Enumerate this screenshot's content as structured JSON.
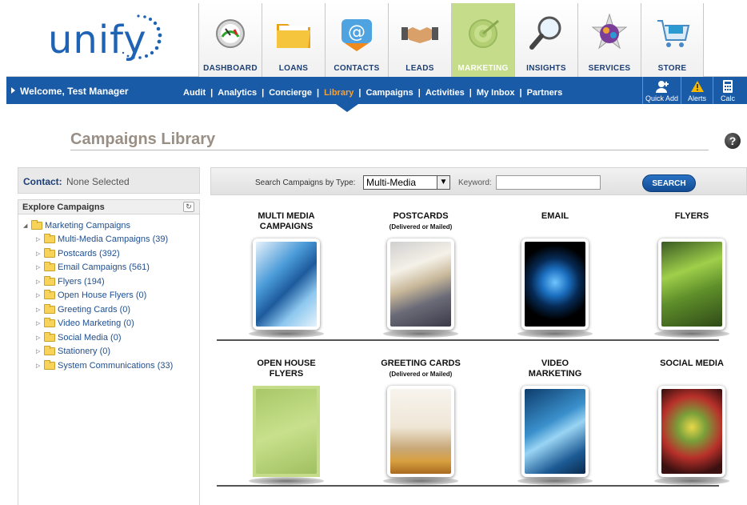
{
  "app": {
    "logo_text": "unify"
  },
  "nav": [
    {
      "label": "DASHBOARD",
      "icon": "gauge-icon"
    },
    {
      "label": "LOANS",
      "icon": "folder-icon"
    },
    {
      "label": "CONTACTS",
      "icon": "email-contact-icon"
    },
    {
      "label": "LEADS",
      "icon": "handshake-icon"
    },
    {
      "label": "MARKETING",
      "icon": "target-icon",
      "active": true
    },
    {
      "label": "INSIGHTS",
      "icon": "magnifier-icon"
    },
    {
      "label": "SERVICES",
      "icon": "globe-icon"
    },
    {
      "label": "STORE",
      "icon": "cart-icon"
    }
  ],
  "bluebar": {
    "welcome": "Welcome, Test Manager",
    "subnav": [
      "Audit",
      "Analytics",
      "Concierge",
      "Library",
      "Campaigns",
      "Activities",
      "My Inbox",
      "Partners"
    ],
    "subnav_active": "Library",
    "tools": [
      {
        "label": "Quick Add",
        "icon": "add-person-icon"
      },
      {
        "label": "Alerts",
        "icon": "warning-icon"
      },
      {
        "label": "Calc",
        "icon": "calculator-icon"
      }
    ]
  },
  "page": {
    "title": "Campaigns Library",
    "help": "?"
  },
  "contact": {
    "label": "Contact:",
    "value": "None Selected"
  },
  "explore": {
    "title": "Explore Campaigns",
    "root": "Marketing Campaigns",
    "items": [
      "Multi-Media Campaigns (39)",
      "Postcards (392)",
      "Email Campaigns (561)",
      "Flyers (194)",
      "Open House Flyers (0)",
      "Greeting Cards (0)",
      "Video Marketing (0)",
      "Social Media (0)",
      "Stationery (0)",
      "System Communications (33)"
    ]
  },
  "search": {
    "type_label": "Search Campaigns by Type:",
    "type_value": "Multi-Media",
    "keyword_label": "Keyword:",
    "keyword_value": "",
    "button": "SEARCH"
  },
  "gallery": {
    "row1": [
      {
        "title": "MULTI MEDIA",
        "title2": "CAMPAIGNS",
        "subtitle": "",
        "thumb": "multimedia"
      },
      {
        "title": "POSTCARDS",
        "title2": "",
        "subtitle": "(Delivered or Mailed)",
        "thumb": "postcards"
      },
      {
        "title": "EMAIL",
        "title2": "",
        "subtitle": "",
        "thumb": "email"
      },
      {
        "title": "FLYERS",
        "title2": "",
        "subtitle": "",
        "thumb": "flyers"
      }
    ],
    "row2": [
      {
        "title": "OPEN HOUSE",
        "title2": "FLYERS",
        "subtitle": "",
        "thumb": "openhouse"
      },
      {
        "title": "GREETING CARDS",
        "title2": "",
        "subtitle": "(Delivered or Mailed)",
        "thumb": "greeting"
      },
      {
        "title": "VIDEO",
        "title2": "MARKETING",
        "subtitle": "",
        "thumb": "video"
      },
      {
        "title": "SOCIAL MEDIA",
        "title2": "",
        "subtitle": "",
        "thumb": "social"
      }
    ]
  }
}
